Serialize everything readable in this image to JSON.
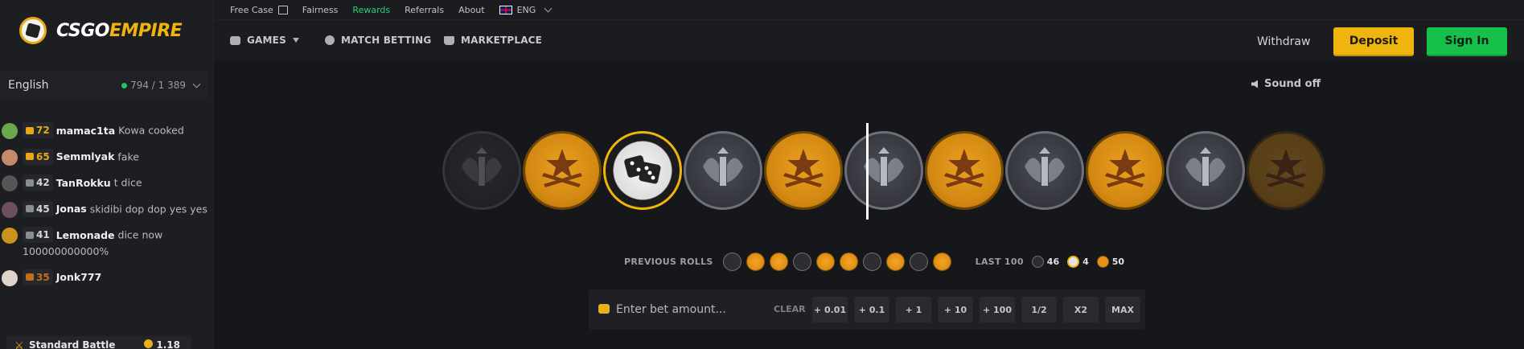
{
  "brand": {
    "name_part1": "CSGO",
    "name_part2": "EMPIRE"
  },
  "topbar": {
    "links": [
      "Free Case",
      "Fairness",
      "Rewards",
      "Referrals",
      "About"
    ],
    "language": "ENG"
  },
  "nav": {
    "games": "GAMES",
    "match_betting": "MATCH BETTING",
    "marketplace": "MARKETPLACE"
  },
  "header_actions": {
    "withdraw": "Withdraw",
    "deposit": "Deposit",
    "sign_in": "Sign In"
  },
  "sidebar": {
    "language": "English",
    "online": "794 / 1 389",
    "messages": [
      {
        "level": "72",
        "user": "mamac1ta",
        "text": "Kowa cooked",
        "avatar_color": "#6aa84f",
        "badge_color": "#e8a913"
      },
      {
        "level": "65",
        "user": "Semmlyak",
        "text": "fake",
        "avatar_color": "#c48b6b",
        "badge_color": "#e8a913"
      },
      {
        "level": "42",
        "user": "TanRokku",
        "text": "t dice",
        "avatar_color": "#555",
        "badge_color": "#8a8c95"
      },
      {
        "level": "45",
        "user": "Jonas",
        "text": "skidibi dop dop yes yes",
        "avatar_color": "#6b5060",
        "badge_color": "#8a8c95"
      },
      {
        "level": "41",
        "user": "Lemonade",
        "text": "dice now 100000000000%",
        "avatar_color": "#c9941e",
        "badge_color": "#8a8c95"
      },
      {
        "level": "35",
        "user": "Jonk777",
        "text": "",
        "avatar_color": "#e0d4c8",
        "badge_color": "#c0701a"
      }
    ],
    "battle": {
      "label": "Standard Battle",
      "coins": "1.18"
    }
  },
  "game": {
    "sound_label": "Sound off",
    "strip": [
      "ct",
      "t",
      "bonus",
      "ct",
      "t",
      "ct",
      "t",
      "ct",
      "t",
      "ct",
      "t"
    ],
    "previous_rolls_label": "PREVIOUS ROLLS",
    "previous_rolls": [
      "ct",
      "t",
      "t",
      "ct",
      "t",
      "t",
      "ct",
      "t",
      "ct",
      "t"
    ],
    "last100_label": "LAST 100",
    "last100": {
      "ct": "46",
      "bonus": "4",
      "t": "50"
    }
  },
  "bet": {
    "placeholder": "Enter bet amount...",
    "clear": "CLEAR",
    "buttons": [
      "+ 0.01",
      "+ 0.1",
      "+ 1",
      "+ 10",
      "+ 100",
      "1/2",
      "X2",
      "MAX"
    ]
  }
}
